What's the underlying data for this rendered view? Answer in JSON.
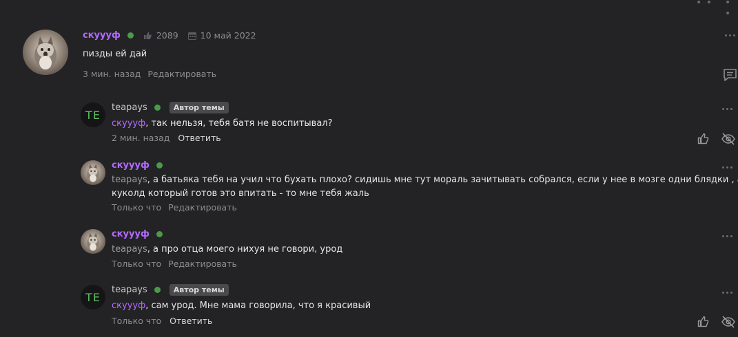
{
  "top_dots": "• •",
  "main_comment": {
    "username": "скуууф",
    "likes": "2089",
    "date": "10 май 2022",
    "text": "пизды ей дай",
    "time": "3 мин. назад",
    "edit": "Редактировать"
  },
  "replies": [
    {
      "username": "teapays",
      "avatar_initials": "TE",
      "badge": "Автор темы",
      "mention": "скуууф",
      "text": ", так нельзя, тебя батя не воспитывал?",
      "time": "2 мин. назад",
      "action": "Ответить"
    },
    {
      "username": "скуууф",
      "mention": "teapays",
      "text_line1": ", а батьяка тебя на учил что бухать плохо? сидишь мне тут мораль зачитывать собрался, если у нее в мозге одни блядки , а ты -",
      "text_line2": "куколд который готов это впитать - то мне тебя жаль",
      "time": "Только что",
      "action": "Редактировать"
    },
    {
      "username": "скуууф",
      "mention": "teapays",
      "text": ", а про отца моего нихуя не говори, урод",
      "time": "Только что",
      "action": "Редактировать"
    },
    {
      "username": "teapays",
      "avatar_initials": "TE",
      "badge": "Автор темы",
      "mention": "скуууф",
      "text": ", сам урод. Мне мама говорила, что я красивый",
      "time": "Только что",
      "action": "Ответить"
    }
  ]
}
